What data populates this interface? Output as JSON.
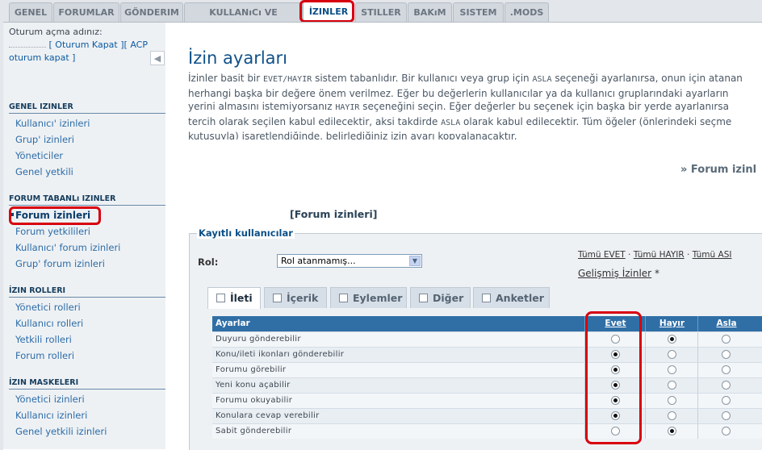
{
  "tabs": [
    {
      "label": "GENEL",
      "active": false
    },
    {
      "label": "FORUMLAR",
      "active": false
    },
    {
      "label": "GÖNDERIM",
      "active": false
    },
    {
      "label": "KULLANıCı VE GRUPLAR",
      "active": false
    },
    {
      "label": "İZINLER",
      "active": true
    },
    {
      "label": "STILLER",
      "active": false
    },
    {
      "label": "BAKıM",
      "active": false
    },
    {
      "label": "SISTEM",
      "active": false
    },
    {
      "label": ".MODS",
      "active": false
    }
  ],
  "sidebar": {
    "login_prefix": "Oturum açma adınız:",
    "logout_text": "[ Oturum Kapat ]",
    "acp_prefix": "[ ACP",
    "acp_suffix": "oturum kapat ]",
    "collapse_icon": "◀",
    "sections": [
      {
        "title": "GENEL IZINLER",
        "items": [
          "Kullanıcı' izinleri",
          "Grup' izinleri",
          "Yöneticiler",
          "Genel yetkili"
        ]
      },
      {
        "title": "FORUM TABANLı IZINLER",
        "items": [
          "Forum izinleri",
          "Forum yetkilileri",
          "Kullanıcı' forum izinleri",
          "Grup' forum izinleri"
        ]
      },
      {
        "title": "İZIN ROLLERI",
        "items": [
          "Yönetici rolleri",
          "Kullanıcı rolleri",
          "Yetkili rolleri",
          "Forum rolleri"
        ]
      },
      {
        "title": "İZIN MASKELERI",
        "items": [
          "Yönetici izinleri",
          "Kullanıcı izinleri",
          "Genel yetkili izinleri"
        ]
      }
    ]
  },
  "main": {
    "title": "İzin ayarları",
    "desc": {
      "l1_a": "İzinler basit bir ",
      "l1_code": "EVET/HAYIR",
      "l1_b": " sistem tabanlıdır. Bir kullanıcı veya grup için ",
      "l1_code2": "ASLA",
      "l1_c": " seçeneği ayarlanırsa, onun için atanan",
      "l2": "herhangi başka bir değere önem verilmez. Eğer bu değerlerin kullanıcılar ya da kullanıcı gruplarındaki ayarların",
      "l3_a": "yerini almasını istemiyorsanız ",
      "l3_code": "HAYIR",
      "l3_b": " seçeneğini seçin. Eğer değerler bu seçenek için başka bir yerde ayarlanırsa",
      "l4_a": "tercih olarak seçilen kabul edilecektir, aksi takdirde ",
      "l4_code": "ASLA",
      "l4_b": " olarak kabul edilecektir. Tüm öğeler (önlerindeki seçme",
      "l5": "kutusuyla) işaretlendiğinde, belirlediğiniz izin ayarı kopyalanacaktır."
    },
    "forum_link": "» Forum izinl",
    "forum_bracket": "[Forum izinleri]",
    "legend": "Kayıtlı kullanıcılar",
    "rol_label": "Rol:",
    "rol_value": "Rol atanmamış...",
    "quick": {
      "all_yes": "Tümü EVET",
      "sep": " · ",
      "all_no": "Tümü HAYIR",
      "all_never": "Tümü ASI"
    },
    "advanced": "Gelişmiş İzinler",
    "advanced_suffix": " *",
    "perm_tabs": [
      "İleti",
      "İçerik",
      "Eylemler",
      "Diğer",
      "Anketler"
    ],
    "table": {
      "header": "Ayarlar",
      "col_yes": "Evet",
      "col_no": "Hayır",
      "col_never": "Asla",
      "rows": [
        {
          "label": "Duyuru gönderebilir",
          "value": "no"
        },
        {
          "label": "Konu/ileti ikonları gönderebilir",
          "value": "yes"
        },
        {
          "label": "Forumu görebilir",
          "value": "yes"
        },
        {
          "label": "Yeni konu açabilir",
          "value": "yes"
        },
        {
          "label": "Forumu okuyabilir",
          "value": "yes"
        },
        {
          "label": "Konulara cevap verebilir",
          "value": "yes"
        },
        {
          "label": "Sabit gönderebilir",
          "value": "no"
        }
      ]
    }
  }
}
